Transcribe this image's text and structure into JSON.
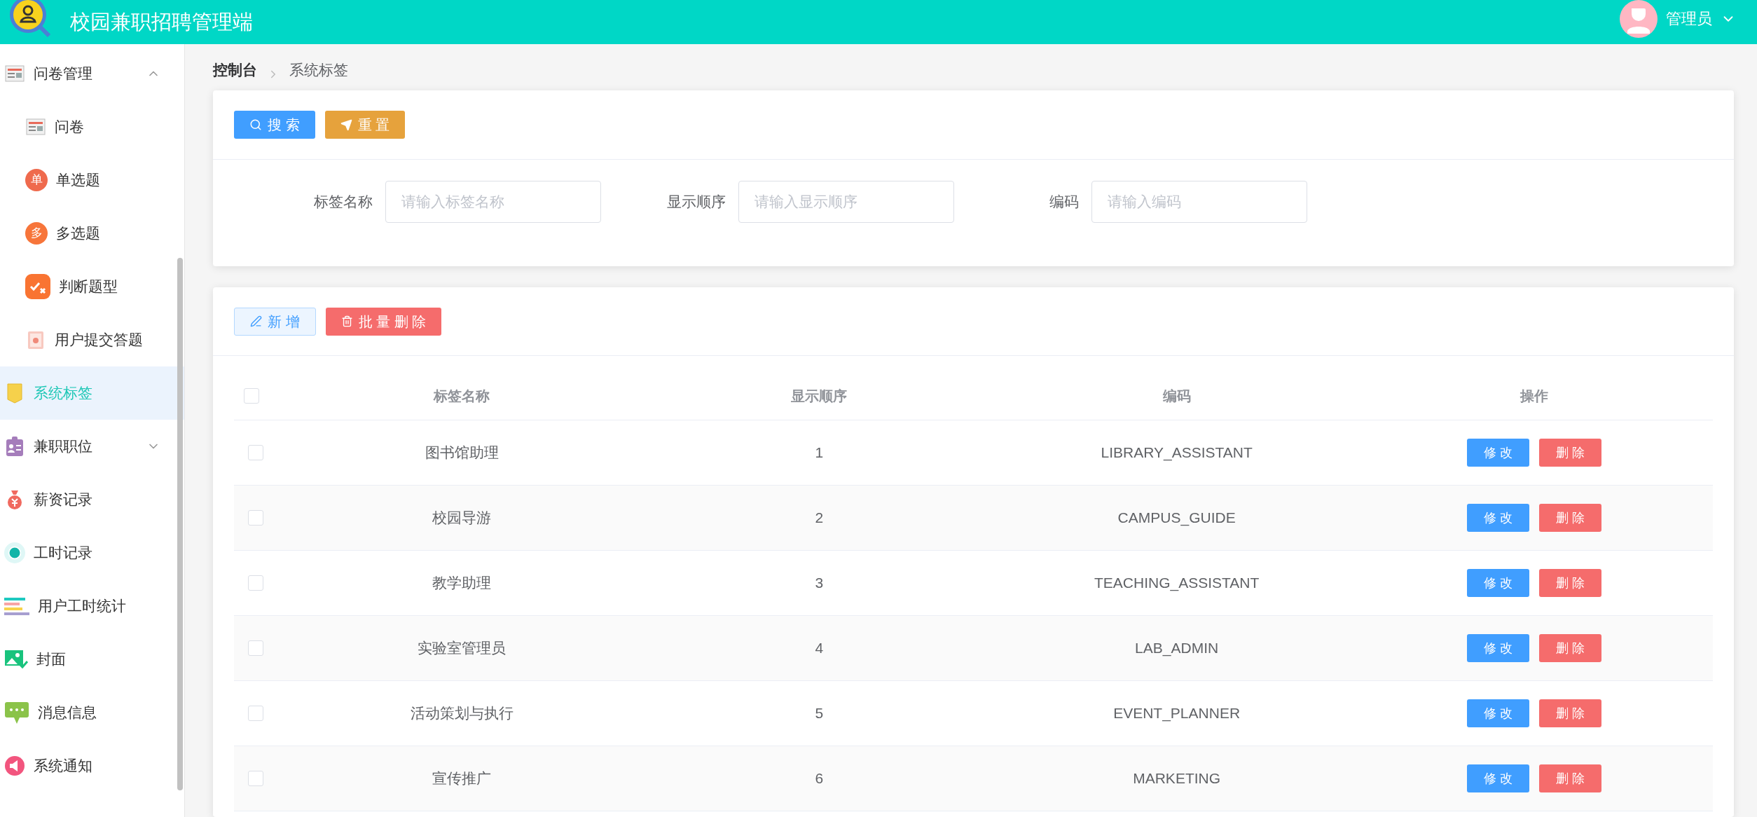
{
  "header": {
    "title": "校园兼职招聘管理端",
    "user": "管理员"
  },
  "sidebar": {
    "items": [
      {
        "label": "问卷管理",
        "kind": "group",
        "expanded": true,
        "selected": false
      },
      {
        "label": "问卷",
        "kind": "sub",
        "selected": false
      },
      {
        "label": "单选题",
        "kind": "sub",
        "badge": "单",
        "selected": false
      },
      {
        "label": "多选题",
        "kind": "sub",
        "badge": "多",
        "selected": false
      },
      {
        "label": "判断题型",
        "kind": "sub",
        "selected": false
      },
      {
        "label": "用户提交答题",
        "kind": "sub",
        "selected": false
      },
      {
        "label": "系统标签",
        "kind": "item",
        "selected": true
      },
      {
        "label": "兼职职位",
        "kind": "group",
        "expanded": false,
        "selected": false
      },
      {
        "label": "薪资记录",
        "kind": "item",
        "selected": false
      },
      {
        "label": "工时记录",
        "kind": "item",
        "selected": false
      },
      {
        "label": "用户工时统计",
        "kind": "item",
        "selected": false
      },
      {
        "label": "封面",
        "kind": "item",
        "selected": false
      },
      {
        "label": "消息信息",
        "kind": "item",
        "selected": false
      },
      {
        "label": "系统通知",
        "kind": "item",
        "selected": false
      }
    ]
  },
  "breadcrumb": [
    "控制台",
    "系统标签"
  ],
  "search_panel": {
    "buttons": [
      "搜 索",
      "重 置"
    ],
    "fields": [
      {
        "label": "标签名称",
        "placeholder": "请输入标签名称"
      },
      {
        "label": "显示顺序",
        "placeholder": "请输入显示顺序"
      },
      {
        "label": "编码",
        "placeholder": "请输入编码"
      }
    ]
  },
  "table_panel": {
    "buttons": [
      "新 增",
      "批 量 删 除"
    ],
    "table": {
      "header_checked": false,
      "columns": [
        "标签名称",
        "显示顺序",
        "编码",
        "操作"
      ],
      "rows": [
        {
          "checked": false,
          "cells": [
            "图书馆助理",
            "1",
            "LIBRARY_ASSISTANT"
          ],
          "actions": [
            "修 改",
            "删 除"
          ]
        },
        {
          "checked": false,
          "cells": [
            "校园导游",
            "2",
            "CAMPUS_GUIDE"
          ],
          "actions": [
            "修 改",
            "删 除"
          ]
        },
        {
          "checked": false,
          "cells": [
            "教学助理",
            "3",
            "TEACHING_ASSISTANT"
          ],
          "actions": [
            "修 改",
            "删 除"
          ]
        },
        {
          "checked": false,
          "cells": [
            "实验室管理员",
            "4",
            "LAB_ADMIN"
          ],
          "actions": [
            "修 改",
            "删 除"
          ]
        },
        {
          "checked": false,
          "cells": [
            "活动策划与执行",
            "5",
            "EVENT_PLANNER"
          ],
          "actions": [
            "修 改",
            "删 除"
          ]
        },
        {
          "checked": false,
          "cells": [
            "宣传推广",
            "6",
            "MARKETING"
          ],
          "actions": [
            "修 改",
            "删 除"
          ]
        }
      ]
    }
  }
}
